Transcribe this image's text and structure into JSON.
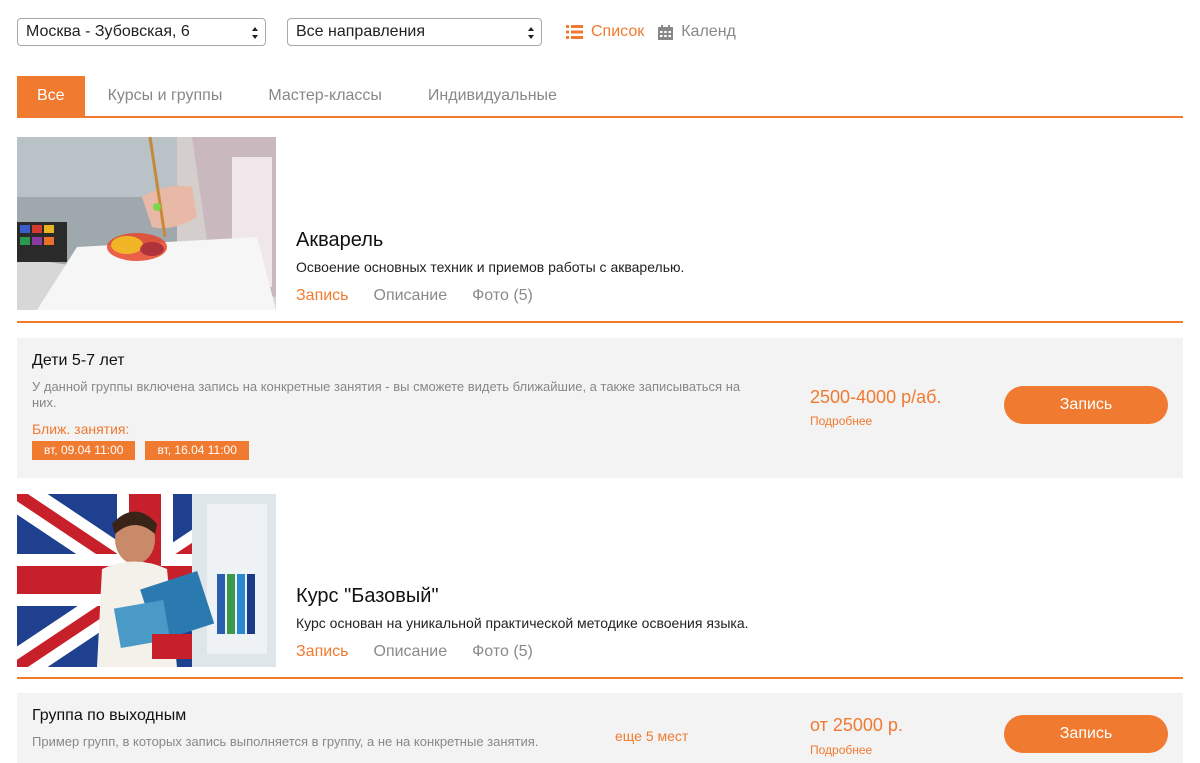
{
  "filters": {
    "city": "Москва - Зубовская, 6",
    "direction": "Все направления"
  },
  "view": {
    "list_label": "Список",
    "calendar_label": "Календ"
  },
  "tabs": [
    {
      "label": "Все",
      "active": true
    },
    {
      "label": "Курсы и группы",
      "active": false
    },
    {
      "label": "Мастер-классы",
      "active": false
    },
    {
      "label": "Индивидуальные",
      "active": false
    }
  ],
  "courses": [
    {
      "title": "Акварель",
      "description": "Освоение основных техник и приемов работы с акварелью.",
      "links": {
        "enroll": "Запись",
        "description": "Описание",
        "photos": "Фото (5)"
      },
      "group": {
        "title": "Дети 5-7 лет",
        "description": "У данной группы включена запись на конкретные занятия - вы сможете видеть ближайшие, а также записываться на них.",
        "next_label": "Ближ. занятия:",
        "dates": [
          "вт, 09.04 11:00",
          "вт, 16.04 11:00"
        ],
        "price": "2500-4000 р/аб.",
        "more": "Подробнее",
        "button": "Запись"
      }
    },
    {
      "title": "Курс \"Базовый\"",
      "description": "Курс основан на уникальной практической методике освоения языка.",
      "links": {
        "enroll": "Запись",
        "description": "Описание",
        "photos": "Фото (5)"
      },
      "group": {
        "title": "Группа по выходным",
        "description": "Пример групп, в которых запись выполняется в группу, а не на конкретные занятия.",
        "seats": "еще 5 мест",
        "price": "от 25000 р.",
        "more": "Подробнее",
        "button": "Запись"
      }
    }
  ],
  "colors": {
    "accent": "#f07a30",
    "muted": "#888888",
    "panel": "#f3f3f3"
  }
}
